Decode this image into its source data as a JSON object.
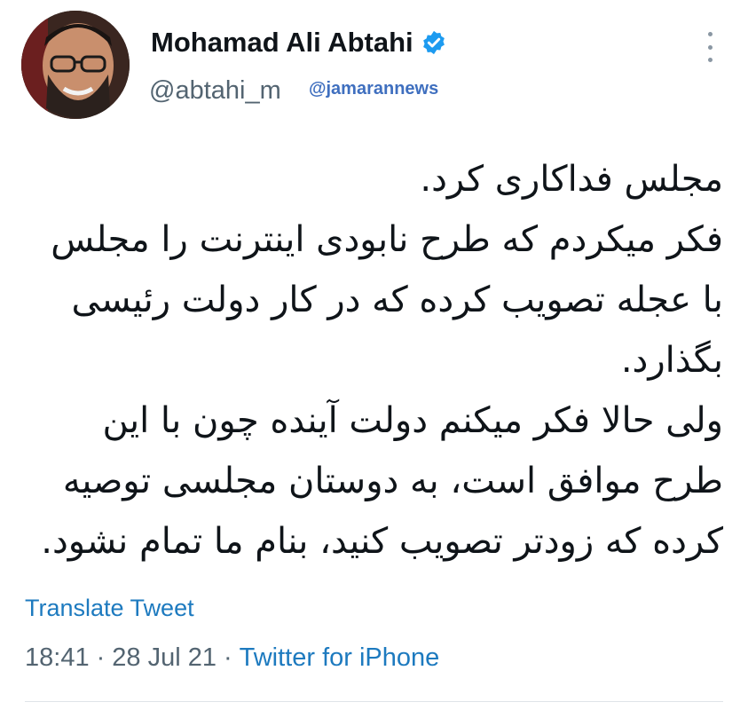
{
  "author": {
    "display_name": "Mohamad Ali Abtahi",
    "handle": "@abtahi_m",
    "verified_icon": "verified-badge-icon",
    "verified_color": "#1d9bf0"
  },
  "watermark_mention": "@jamarannews",
  "tweet": {
    "lines": [
      "مجلس فداکاری کرد.",
      "فکر میکردم که طرح نابودی اینترنت را مجلس",
      "با عجله تصویب کرده که در کار دولت رئیسی",
      "بگذارد.",
      "ولی حالا فکر میکنم دولت آینده چون با این",
      "طرح موافق است، به دوستان مجلسی توصیه",
      "کرده که زودتر تصویب کنید، بنام ما تمام نشود."
    ]
  },
  "translate_label": "Translate Tweet",
  "meta": {
    "time": "18:41",
    "separator": "·",
    "date": "28 Jul 21",
    "source": "Twitter for iPhone"
  },
  "colors": {
    "link": "#1d7abf",
    "muted": "#536471",
    "mention": "#3f6fbf"
  }
}
